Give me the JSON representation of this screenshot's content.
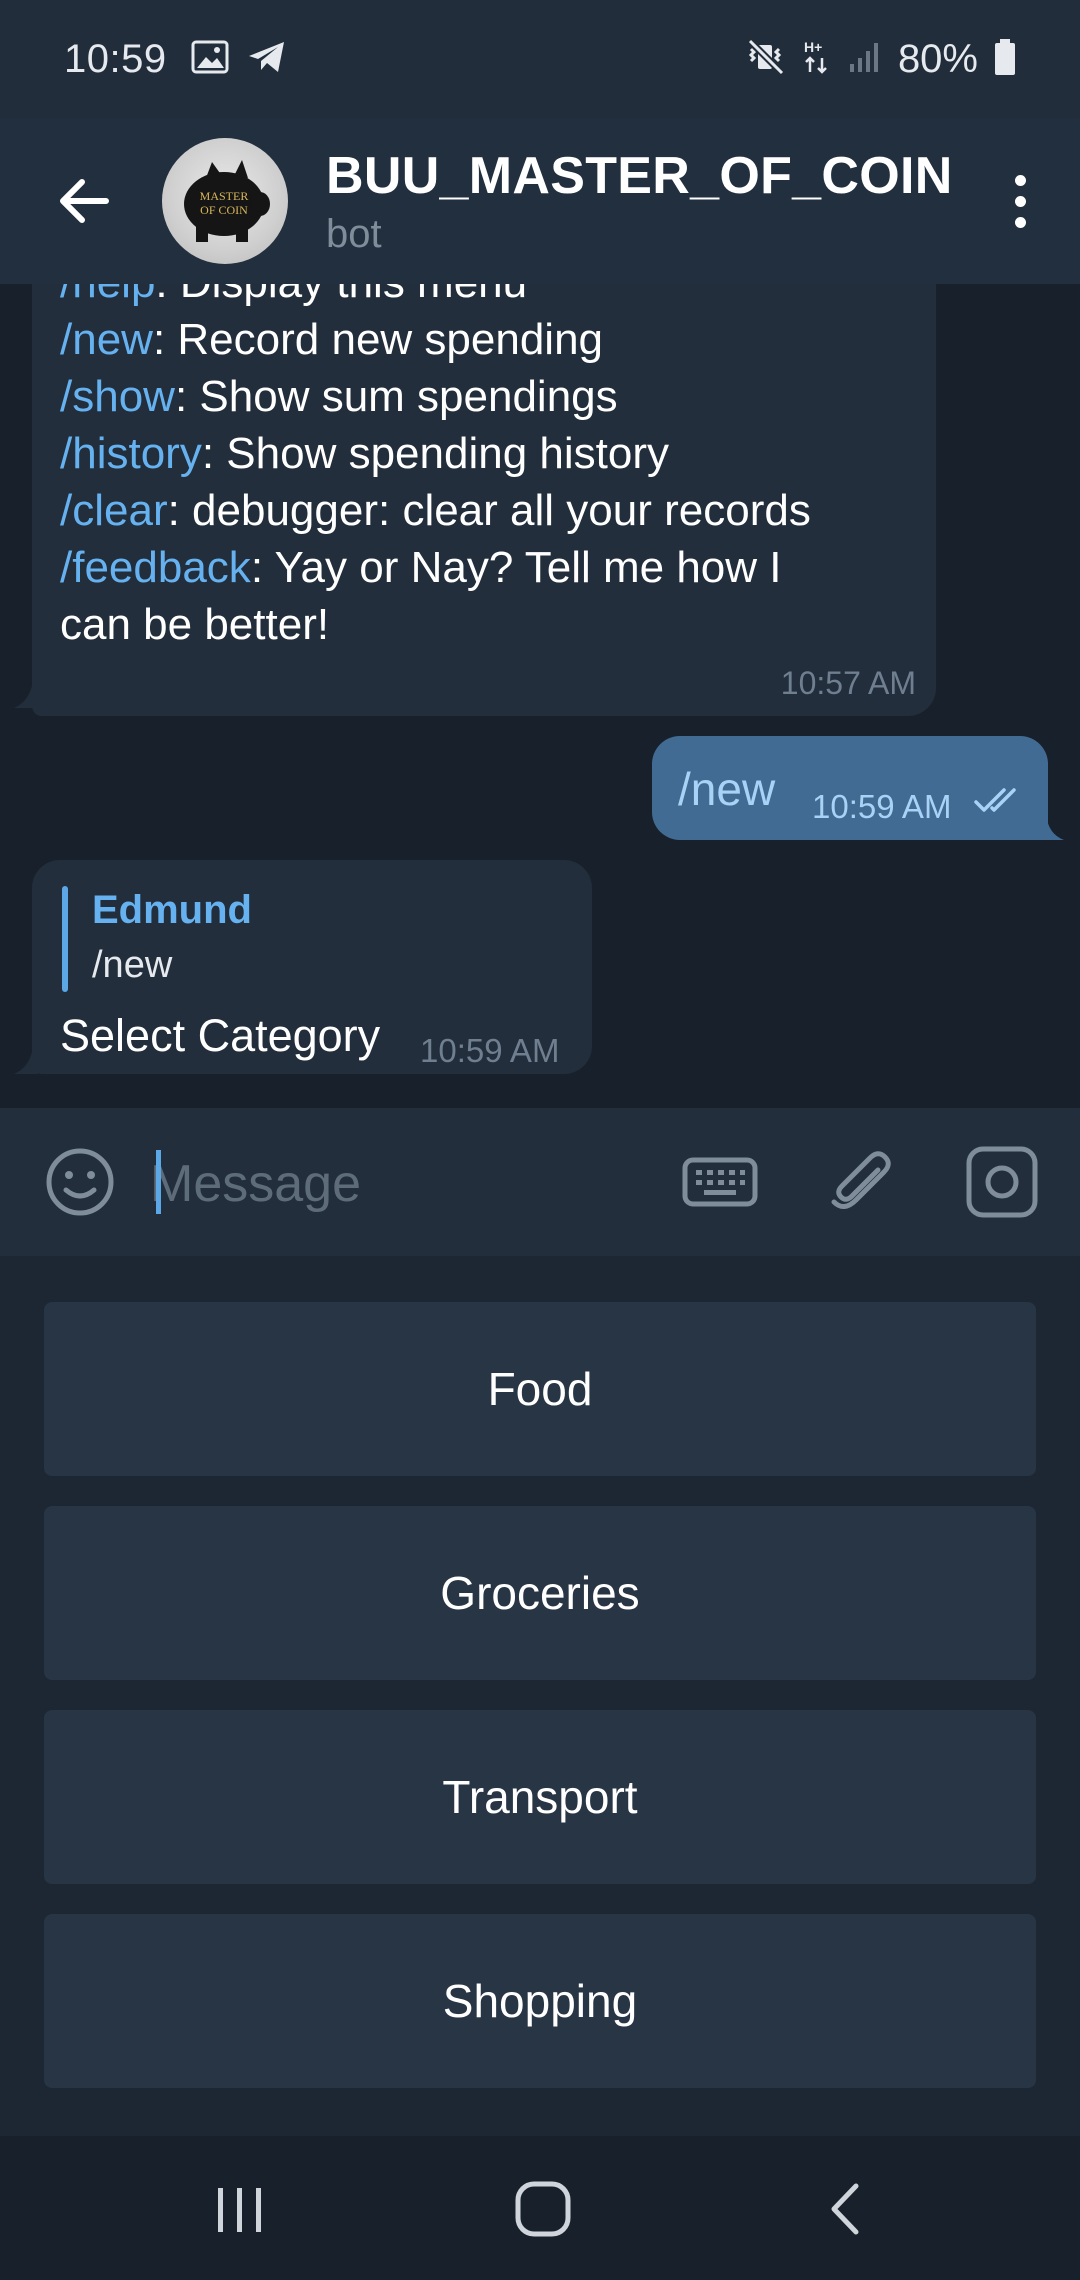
{
  "status_bar": {
    "time": "10:59",
    "battery": "80%",
    "left_icons": [
      "image-icon",
      "telegram-icon"
    ],
    "right_icons": [
      "mute-vibrate-icon",
      "network-hplus-icon",
      "signal-icon",
      "battery-icon"
    ]
  },
  "header": {
    "title": "BUU_MASTER_OF_COIN",
    "subtitle": "bot",
    "avatar_text_line1": "MASTER",
    "avatar_text_line2": "OF COIN"
  },
  "messages": {
    "help": {
      "lines": [
        {
          "cmd": "/help",
          "text": ": Display this menu"
        },
        {
          "cmd": "/new",
          "text": ": Record new spending"
        },
        {
          "cmd": "/show",
          "text": ": Show sum spendings"
        },
        {
          "cmd": "/history",
          "text": ": Show spending history"
        },
        {
          "cmd": "/clear",
          "text": ": debugger: clear all your records"
        },
        {
          "cmd": "/feedback",
          "text": ": Yay or Nay? Tell me how I"
        },
        {
          "cmd": "",
          "text": "can be better!"
        }
      ],
      "time": "10:57 AM"
    },
    "outgoing": {
      "text": "/new",
      "time": "10:59 AM"
    },
    "reply": {
      "quote_name": "Edmund",
      "quote_text": "/new",
      "text": "Select Category",
      "time": "10:59 AM"
    }
  },
  "input": {
    "placeholder": "Message",
    "value": ""
  },
  "keyboard": {
    "buttons": [
      "Food",
      "Groceries",
      "Transport",
      "Shopping"
    ]
  },
  "colors": {
    "accent": "#66b2f0",
    "outgoing_bubble": "#426b93",
    "incoming_bubble": "#222e3b",
    "background": "#18212b"
  }
}
